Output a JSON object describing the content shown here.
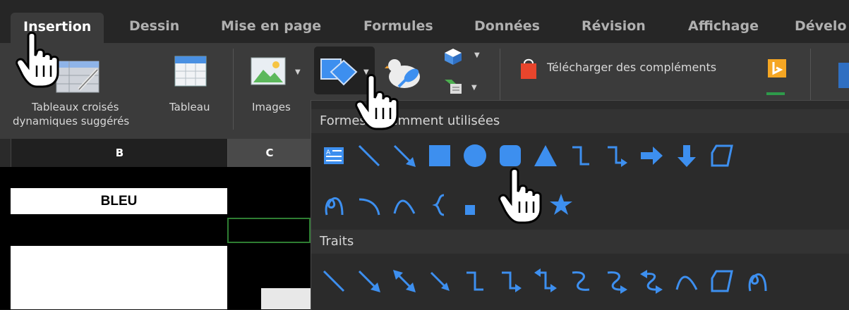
{
  "tabs": [
    {
      "label": "Insertion",
      "active": true
    },
    {
      "label": "Dessin"
    },
    {
      "label": "Mise en page"
    },
    {
      "label": "Formules"
    },
    {
      "label": "Données"
    },
    {
      "label": "Révision"
    },
    {
      "label": "Affichage"
    },
    {
      "label": "Dévelo"
    }
  ],
  "ribbon": {
    "pivot_label_line1": "Tableaux croisés",
    "pivot_label_line2": "dynamiques suggérés",
    "table_label": "Tableau",
    "images_label": "Images",
    "addins_label": "Télécharger des compléments"
  },
  "sheet": {
    "col_b": "B",
    "col_c": "C",
    "cell_text": "BLEU"
  },
  "popup": {
    "recent_title": "Formes récemment utilisées",
    "lines_title": "Traits"
  },
  "colors": {
    "accent_blue": "#3d8fef",
    "ribbon_bg": "#3b3b3b",
    "tab_bg": "#262626",
    "popup_bg": "#2b2b2b",
    "bing_orange": "#f5a623",
    "bag_red": "#e8452c"
  },
  "icons": [
    "pivot-table-icon",
    "table-icon",
    "image-icon",
    "shapes-icon",
    "3d-model-icon",
    "smartart-icon",
    "store-bag-icon",
    "bing-icon",
    "hand-cursor-icon"
  ]
}
